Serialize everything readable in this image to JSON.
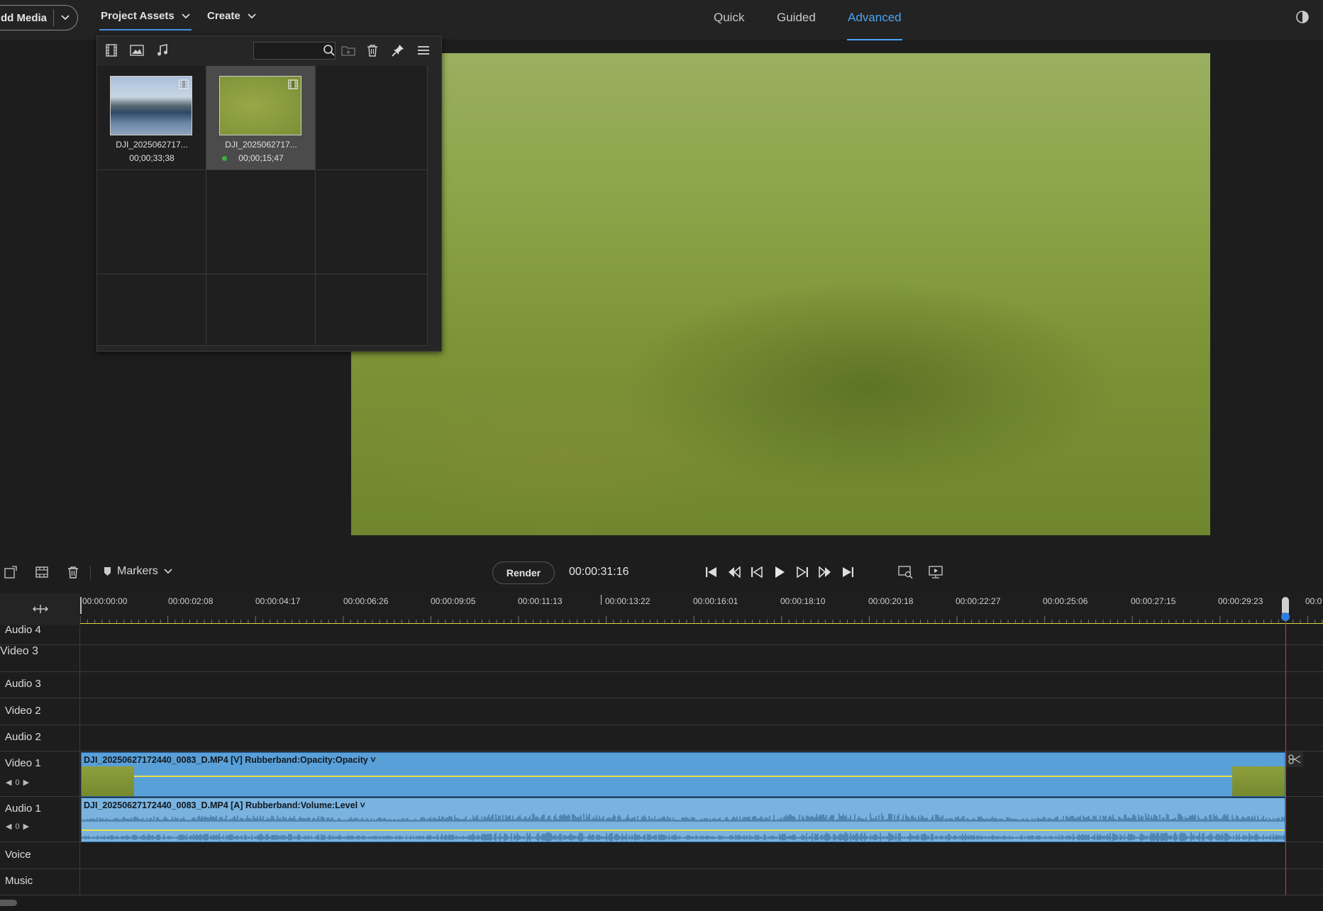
{
  "topbar": {
    "add_media_label": "dd Media",
    "project_assets_label": "Project Assets",
    "create_label": "Create",
    "modes": [
      "Quick",
      "Guided",
      "Advanced"
    ],
    "active_mode": "Advanced"
  },
  "assets_panel": {
    "search_placeholder": "",
    "items": [
      {
        "name": "DJI_2025062717...",
        "duration": "00;00;33;38",
        "selected": false
      },
      {
        "name": "DJI_2025062717...",
        "duration": "00;00;15;47",
        "selected": true
      }
    ]
  },
  "transport": {
    "markers_label": "Markers",
    "render_label": "Render",
    "timecode": "00:00:31:16"
  },
  "ruler": {
    "ticks": [
      "00:00:00:00",
      "00:00:02:08",
      "00:00:04:17",
      "00:00:06:26",
      "00:00:09:05",
      "00:00:11:13",
      "00:00:13:22",
      "00:00:16:01",
      "00:00:18:10",
      "00:00:20:18",
      "00:00:22:27",
      "00:00:25:06",
      "00:00:27:15",
      "00:00:29:23",
      "00:0"
    ]
  },
  "tracks": {
    "audio4": "Audio 4",
    "video3": "Video 3",
    "audio3": "Audio 3",
    "video2": "Video 2",
    "audio2": "Audio 2",
    "video1": "Video 1",
    "audio1": "Audio 1",
    "voice": "Voice",
    "music": "Music",
    "video1_value": "0",
    "audio1_value": "0"
  },
  "clips": {
    "video_label": "DJI_20250627172440_0083_D.MP4 [V] Rubberband:Opacity:Opacity ˅",
    "audio_label": "DJI_20250627172440_0083_D.MP4 [A] Rubberband:Volume:Level ˅"
  },
  "colors": {
    "accent": "#4da3f2",
    "clip_video": "#5aa0d8",
    "clip_audio": "#7ab3df",
    "rubberband": "#e6e04a",
    "playhead": "#d23a3a"
  }
}
